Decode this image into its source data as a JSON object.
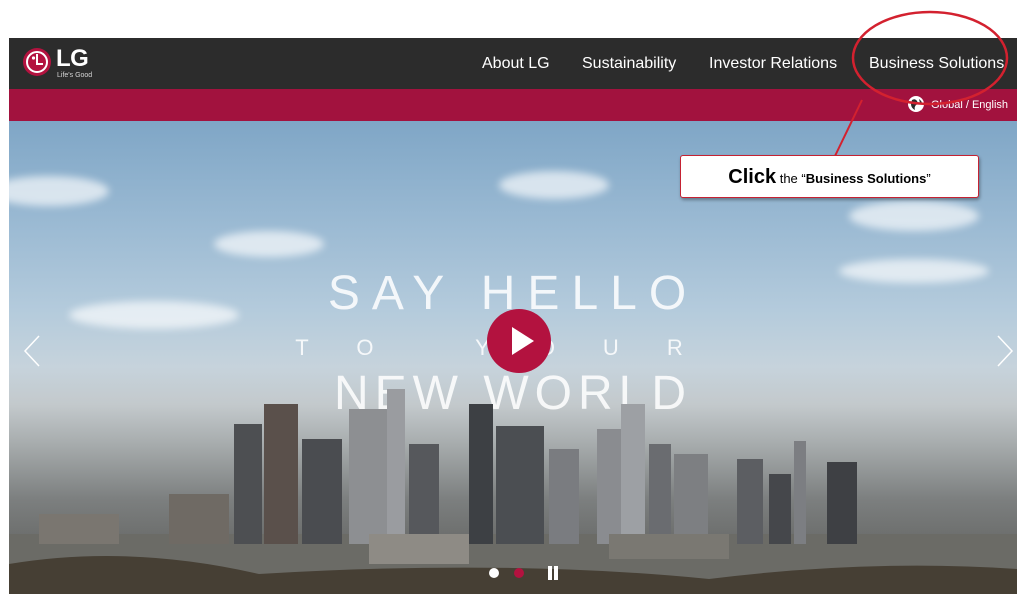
{
  "header": {
    "logo_text": "LG",
    "logo_tagline": "Life's Good",
    "nav": [
      "About LG",
      "Sustainability",
      "Investor Relations",
      "Business Solutions"
    ]
  },
  "subbar": {
    "region_label": "Global / English"
  },
  "hero": {
    "line1": "SAY HELLO",
    "line2": "TO YOUR",
    "line3": "NEW WORLD"
  },
  "carousel": {
    "slides": 2,
    "active_slide": 2
  },
  "annotation": {
    "callout_click": "Click",
    "callout_mid": " the “",
    "callout_target": "Business Solutions",
    "callout_end": "”"
  },
  "colors": {
    "brand": "#a2123e",
    "nav_bg": "#2c2c2c",
    "annotation": "#d3212f"
  }
}
